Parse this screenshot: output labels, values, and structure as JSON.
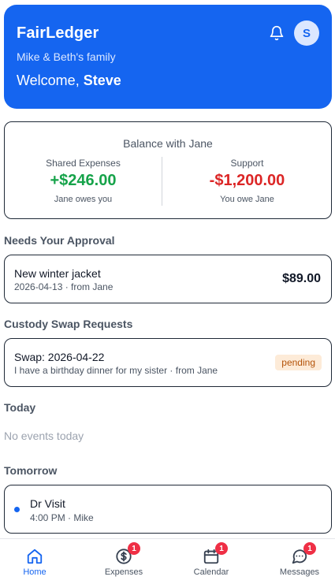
{
  "header": {
    "app_title": "FairLedger",
    "family_name": "Mike & Beth's family",
    "welcome_prefix": "Welcome,",
    "user_name": "Steve",
    "avatar_initial": "S",
    "bell_icon": "bell-icon",
    "background_color": "#1565f0"
  },
  "balance": {
    "title": "Balance with Jane",
    "shared": {
      "label": "Shared Expenses",
      "amount": "+$246.00",
      "note": "Jane owes you",
      "color": "#16a34a"
    },
    "support": {
      "label": "Support",
      "amount": "-$1,200.00",
      "note": "You owe Jane",
      "color": "#dc2626"
    }
  },
  "approval": {
    "section_title": "Needs Your Approval",
    "item": {
      "title": "New winter jacket",
      "subtitle": "2026-04-13 · from Jane",
      "amount": "$89.00"
    }
  },
  "swaps": {
    "section_title": "Custody Swap Requests",
    "item": {
      "title": "Swap: 2026-04-22",
      "subtitle": "I have a birthday dinner for my sister · from Jane",
      "status": "pending"
    }
  },
  "today": {
    "section_title": "Today",
    "empty_text": "No events today"
  },
  "tomorrow": {
    "section_title": "Tomorrow",
    "event": {
      "title": "Dr Visit",
      "subtitle": "4:00 PM · Mike"
    }
  },
  "tabs": [
    {
      "label": "Home",
      "icon": "home-icon",
      "active": true,
      "badge": ""
    },
    {
      "label": "Expenses",
      "icon": "dollar-icon",
      "active": false,
      "badge": "1"
    },
    {
      "label": "Calendar",
      "icon": "calendar-icon",
      "active": false,
      "badge": "1"
    },
    {
      "label": "Messages",
      "icon": "chat-icon",
      "active": false,
      "badge": "1"
    }
  ]
}
